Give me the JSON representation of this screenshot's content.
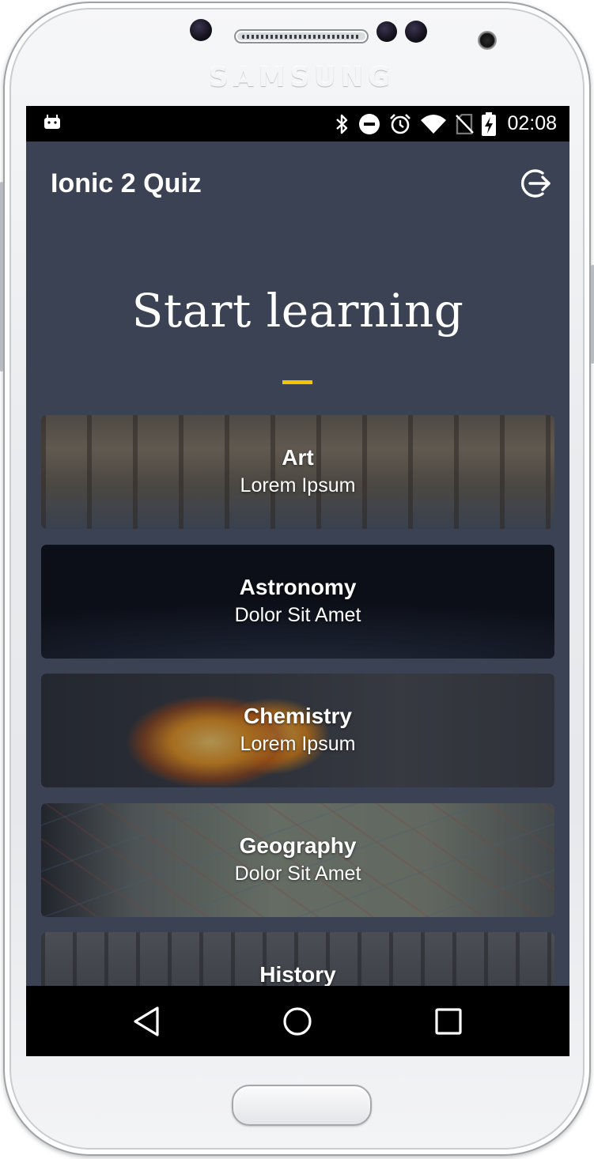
{
  "device": {
    "brand": "SAMSUNG"
  },
  "status_bar": {
    "left_icon": "android-notification-icon",
    "icons": [
      "bluetooth-icon",
      "do-not-disturb-icon",
      "alarm-icon",
      "wifi-icon",
      "no-sim-icon",
      "battery-charging-icon"
    ],
    "time": "02:08"
  },
  "app_bar": {
    "title": "Ionic 2 Quiz",
    "logout_icon": "logout-icon"
  },
  "hero": {
    "title": "Start learning",
    "accent_color": "#f4c400"
  },
  "categories": [
    {
      "title": "Art",
      "subtitle": "Lorem Ipsum"
    },
    {
      "title": "Astronomy",
      "subtitle": "Dolor Sit Amet"
    },
    {
      "title": "Chemistry",
      "subtitle": "Lorem Ipsum"
    },
    {
      "title": "Geography",
      "subtitle": "Dolor Sit Amet"
    },
    {
      "title": "History",
      "subtitle": ""
    }
  ],
  "nav_bar": {
    "buttons": [
      "back-icon",
      "home-icon",
      "recents-icon"
    ]
  },
  "colors": {
    "background": "#3b4253",
    "status_bar": "#000000",
    "accent": "#f4c400"
  }
}
